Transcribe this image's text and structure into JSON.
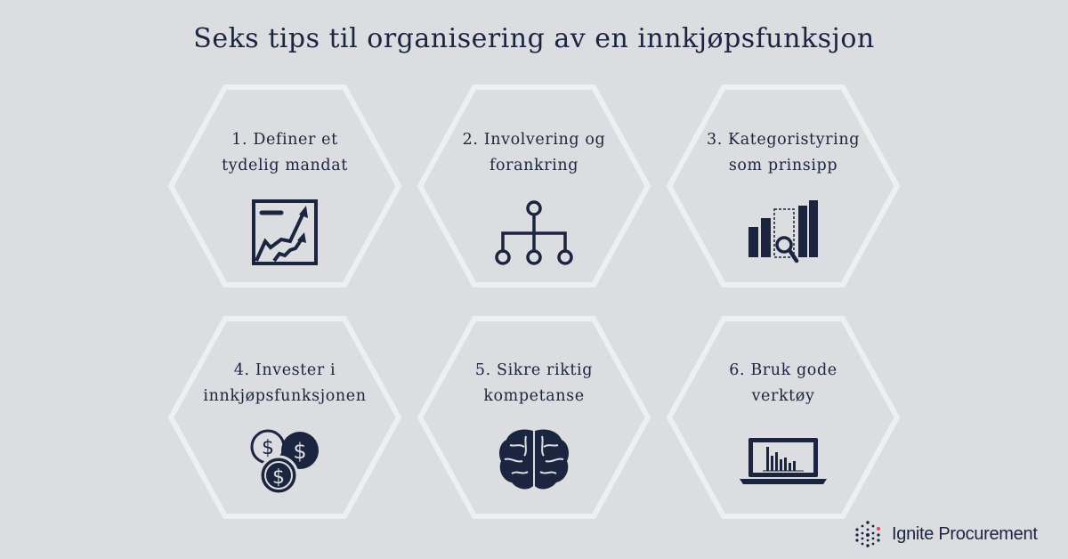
{
  "title": "Seks tips til organisering av en innkjøpsfunksjon",
  "tips": [
    {
      "line1": "1. Definer et",
      "line2": "tydelig mandat",
      "icon": "growth-chart-icon"
    },
    {
      "line1": "2. Involvering og",
      "line2": "forankring",
      "icon": "hierarchy-icon"
    },
    {
      "line1": "3. Kategoristyring",
      "line2": "som prinsipp",
      "icon": "bar-chart-magnifier-icon"
    },
    {
      "line1": "4. Invester i",
      "line2": "innkjøpsfunksjonen",
      "icon": "coins-icon"
    },
    {
      "line1": "5. Sikre riktig",
      "line2": "kompetanse",
      "icon": "brain-icon"
    },
    {
      "line1": "6. Bruk gode",
      "line2": "verktøy",
      "icon": "laptop-chart-icon"
    }
  ],
  "logo": {
    "text": "Ignite Procurement"
  },
  "colors": {
    "background": "#dcdde1",
    "text": "#1b2540",
    "hex_stroke": "#eeeff1",
    "accent": "#e8435a"
  }
}
